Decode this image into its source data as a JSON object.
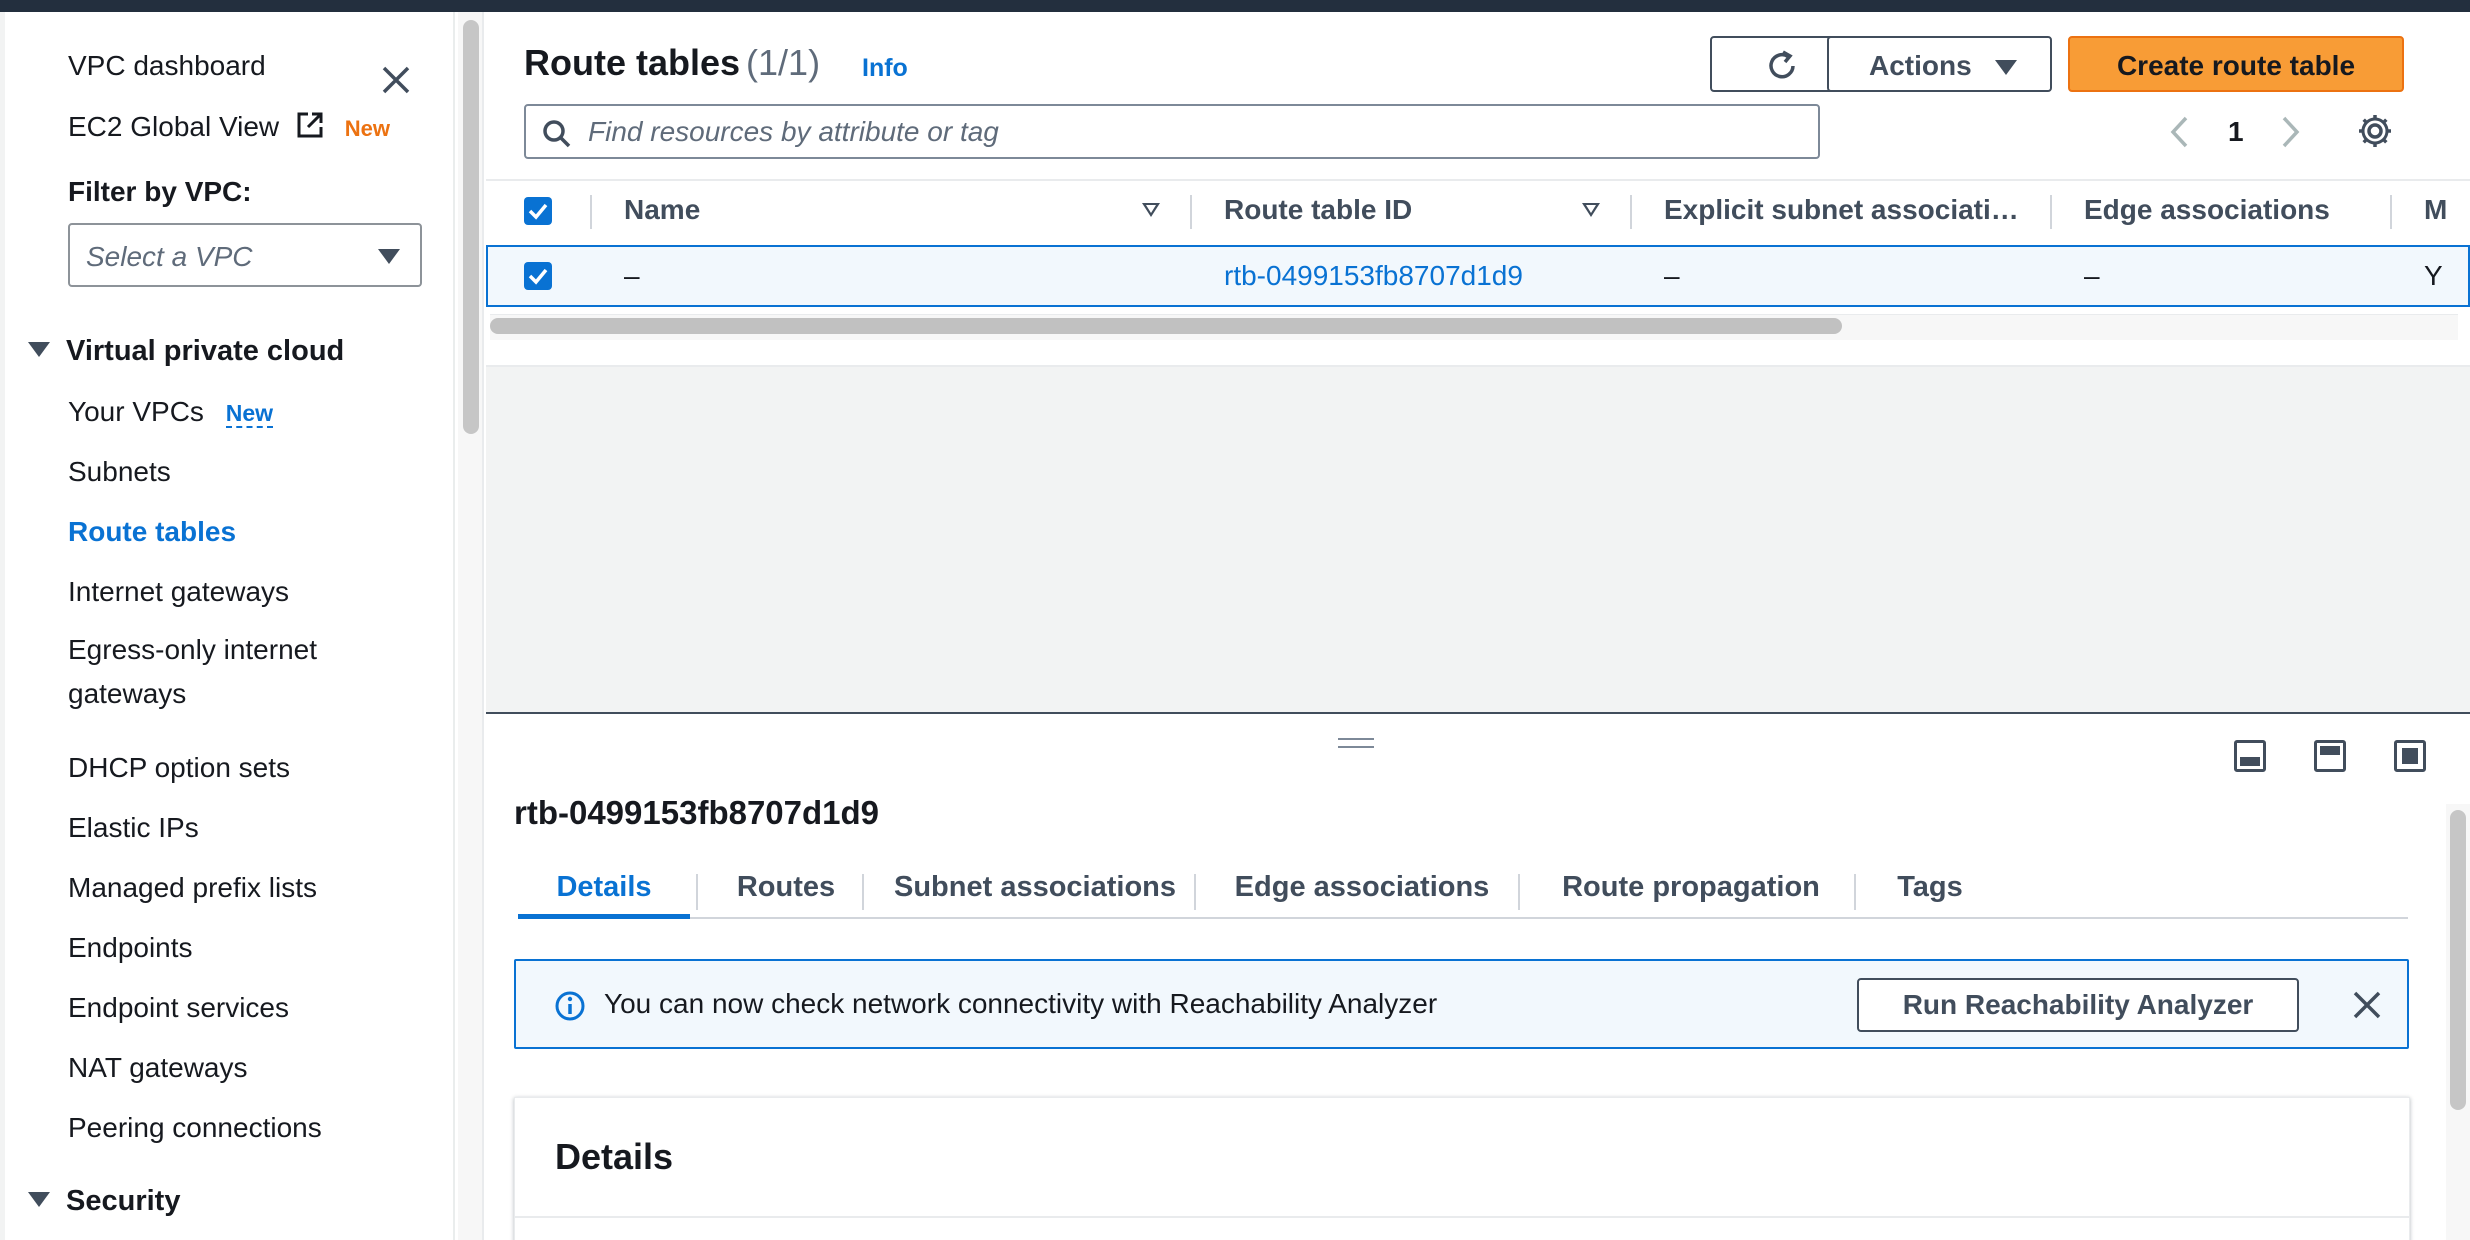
{
  "sidebar": {
    "dashboard": "VPC dashboard",
    "ec2_global_view": "EC2 Global View",
    "ec2_badge": "New",
    "filter_label": "Filter by VPC:",
    "filter_placeholder": "Select a VPC",
    "section_vpc": "Virtual private cloud",
    "items": [
      {
        "label": "Your VPCs",
        "badge": "New"
      },
      {
        "label": "Subnets"
      },
      {
        "label": "Route tables",
        "active": true
      },
      {
        "label": "Internet gateways"
      },
      {
        "label": "Egress-only internet gateways"
      },
      {
        "label": "DHCP option sets"
      },
      {
        "label": "Elastic IPs"
      },
      {
        "label": "Managed prefix lists"
      },
      {
        "label": "Endpoints"
      },
      {
        "label": "Endpoint services"
      },
      {
        "label": "NAT gateways"
      },
      {
        "label": "Peering connections"
      }
    ],
    "egress_line1": "Egress-only internet",
    "egress_line2": "gateways",
    "section_security": "Security"
  },
  "header": {
    "title": "Route tables",
    "count": "(1/1)",
    "info": "Info",
    "actions_label": "Actions",
    "create_label": "Create route table",
    "search_placeholder": "Find resources by attribute or tag",
    "page_number": "1"
  },
  "table": {
    "columns": [
      "Name",
      "Route table ID",
      "Explicit subnet associati…",
      "Edge associations",
      "M"
    ],
    "rows": [
      {
        "name": "–",
        "route_table_id": "rtb-0499153fb8707d1d9",
        "explicit_subnet": "–",
        "edge": "–",
        "main": "Y",
        "selected": true
      }
    ]
  },
  "split_panel": {
    "title": "rtb-0499153fb8707d1d9",
    "tabs": [
      "Details",
      "Routes",
      "Subnet associations",
      "Edge associations",
      "Route propagation",
      "Tags"
    ],
    "active_tab": "Details",
    "alert_message": "You can now check network connectivity with Reachability Analyzer",
    "alert_button": "Run Reachability Analyzer",
    "details_header": "Details"
  },
  "colors": {
    "accent": "#0972d3",
    "primary_button": "#f89c36",
    "new_badge": "#ec7211",
    "topbar": "#232f3e"
  },
  "icons": [
    "close-icon",
    "external-link-icon",
    "refresh-icon",
    "caret-down-icon",
    "search-icon",
    "chevron-left-icon",
    "chevron-right-icon",
    "gear-icon",
    "check-icon",
    "info-icon",
    "panel-bottom-icon",
    "panel-side-icon",
    "panel-hidden-icon"
  ]
}
